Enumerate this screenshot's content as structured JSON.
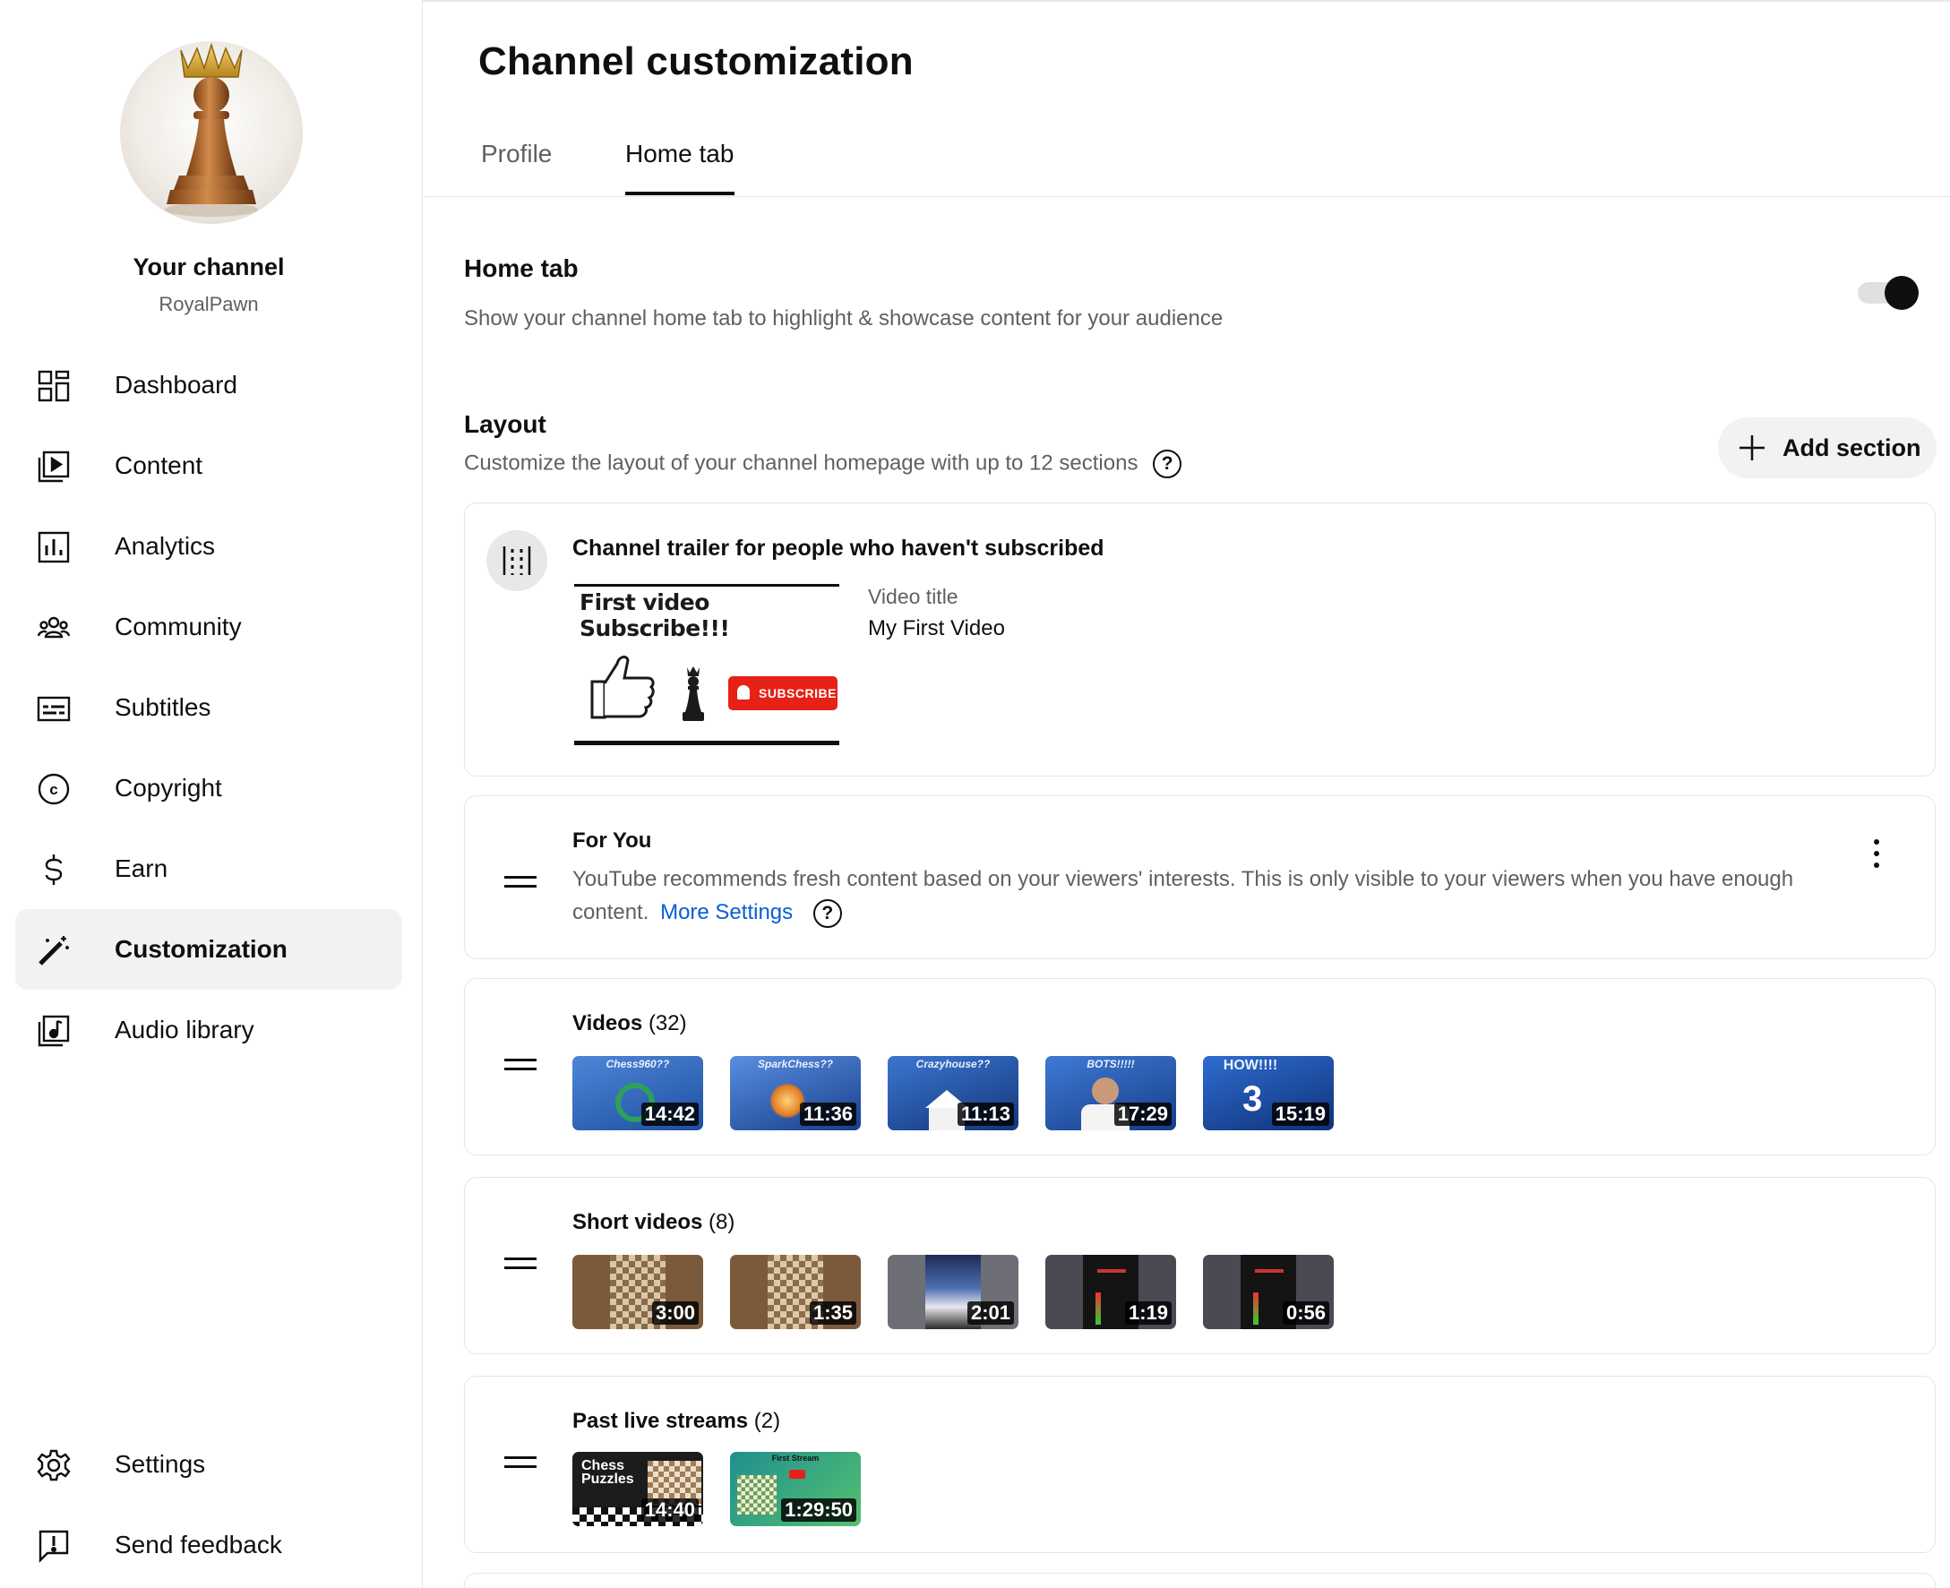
{
  "sidebar": {
    "channel_title": "Your channel",
    "channel_handle": "RoyalPawn",
    "avatar_icon": "chess-king-icon",
    "items": [
      {
        "id": "dashboard",
        "label": "Dashboard",
        "icon": "dashboard-icon"
      },
      {
        "id": "content",
        "label": "Content",
        "icon": "content-icon"
      },
      {
        "id": "analytics",
        "label": "Analytics",
        "icon": "analytics-icon"
      },
      {
        "id": "community",
        "label": "Community",
        "icon": "community-icon"
      },
      {
        "id": "subtitles",
        "label": "Subtitles",
        "icon": "subtitles-icon"
      },
      {
        "id": "copyright",
        "label": "Copyright",
        "icon": "copyright-icon"
      },
      {
        "id": "earn",
        "label": "Earn",
        "icon": "dollar-icon"
      },
      {
        "id": "customization",
        "label": "Customization",
        "icon": "magic-wand-icon",
        "active": true
      },
      {
        "id": "audio-library",
        "label": "Audio library",
        "icon": "audio-library-icon"
      }
    ],
    "footer_items": [
      {
        "id": "settings",
        "label": "Settings",
        "icon": "gear-icon"
      },
      {
        "id": "send-feedback",
        "label": "Send feedback",
        "icon": "feedback-icon"
      }
    ]
  },
  "header": {
    "title": "Channel customization",
    "tabs": [
      {
        "label": "Profile",
        "active": false
      },
      {
        "label": "Home tab",
        "active": true
      }
    ]
  },
  "home_tab": {
    "heading": "Home tab",
    "description": "Show your channel home tab to highlight & showcase content for your audience",
    "toggle_on": true
  },
  "layout": {
    "heading": "Layout",
    "description": "Customize the layout of your channel homepage with up to 12 sections",
    "help_glyph": "?",
    "add_section_label": "Add section"
  },
  "sections": {
    "trailer": {
      "title": "Channel trailer for people who haven't subscribed",
      "thumbnail_text": "First video Subscribe!!!",
      "subscribe_badge": "SUBSCRIBE",
      "video_title_label": "Video title",
      "video_title": "My First Video"
    },
    "for_you": {
      "title": "For You",
      "description": "YouTube recommends fresh content based on your viewers' interests. This is only visible to your viewers when you have enough content.",
      "more_settings": "More Settings"
    },
    "videos": {
      "title": "Videos",
      "count": "(32)",
      "items": [
        {
          "caption": "Chess960??",
          "duration": "14:42"
        },
        {
          "caption": "SparkChess??",
          "duration": "11:36"
        },
        {
          "caption": "Crazyhouse??",
          "duration": "11:13"
        },
        {
          "caption": "BOTS!!!!!",
          "duration": "17:29"
        },
        {
          "caption": "HOW!!!!",
          "duration": "15:19"
        }
      ]
    },
    "shorts": {
      "title": "Short videos",
      "count": "(8)",
      "items": [
        {
          "duration": "3:00"
        },
        {
          "duration": "1:35"
        },
        {
          "duration": "2:01"
        },
        {
          "duration": "1:19"
        },
        {
          "duration": "0:56"
        }
      ]
    },
    "live": {
      "title": "Past live streams",
      "count": "(2)",
      "items": [
        {
          "caption": "Chess Puzzles",
          "duration": "14:40"
        },
        {
          "caption": "First Stream",
          "duration": "1:29:50"
        }
      ]
    }
  },
  "colors": {
    "accent": "#065fd4",
    "text_primary": "#0f0f0f",
    "text_secondary": "#606060",
    "active_bg": "#f2f2f2",
    "subscribe_red": "#e62117"
  }
}
